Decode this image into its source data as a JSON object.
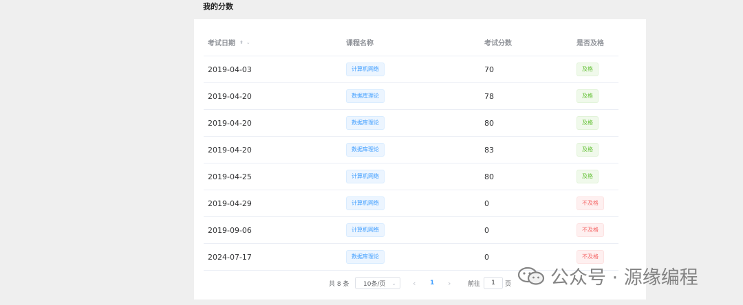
{
  "page": {
    "title": "我的分数"
  },
  "table": {
    "headers": {
      "date": "考试日期",
      "course": "课程名称",
      "score": "考试分数",
      "pass": "是否及格"
    },
    "rows": [
      {
        "date": "2019-04-03",
        "course": "计算机网络",
        "score": "70",
        "pass": "及格",
        "pass_status": "pass"
      },
      {
        "date": "2019-04-20",
        "course": "数据库理论",
        "score": "78",
        "pass": "及格",
        "pass_status": "pass"
      },
      {
        "date": "2019-04-20",
        "course": "数据库理论",
        "score": "80",
        "pass": "及格",
        "pass_status": "pass"
      },
      {
        "date": "2019-04-20",
        "course": "数据库理论",
        "score": "83",
        "pass": "及格",
        "pass_status": "pass"
      },
      {
        "date": "2019-04-25",
        "course": "计算机网络",
        "score": "80",
        "pass": "及格",
        "pass_status": "pass"
      },
      {
        "date": "2019-04-29",
        "course": "计算机网络",
        "score": "0",
        "pass": "不及格",
        "pass_status": "fail"
      },
      {
        "date": "2019-09-06",
        "course": "计算机网络",
        "score": "0",
        "pass": "不及格",
        "pass_status": "fail"
      },
      {
        "date": "2024-07-17",
        "course": "数据库理论",
        "score": "0",
        "pass": "不及格",
        "pass_status": "fail"
      }
    ]
  },
  "pagination": {
    "total": "共 8 条",
    "page_size": "10条/页",
    "current_page": "1",
    "goto_label": "前往",
    "goto_value": "1",
    "page_suffix": "页"
  },
  "watermark": {
    "text": "公众号 · 源缘编程"
  },
  "colors": {
    "accent": "#409eff",
    "pass": "#67c23a",
    "fail": "#f56c6c",
    "background": "#efefef"
  }
}
